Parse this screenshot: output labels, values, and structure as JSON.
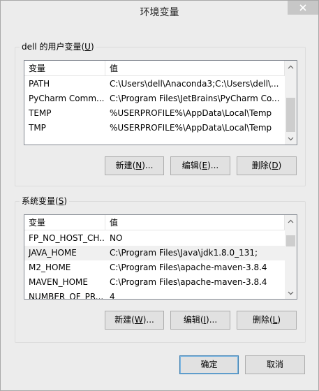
{
  "window": {
    "title": "环境变量"
  },
  "user_section": {
    "title_prefix": "dell 的用户变量(",
    "title_hotkey": "U",
    "title_suffix": ")",
    "columns": [
      "变量",
      "值"
    ],
    "rows": [
      {
        "name": "PATH",
        "value": "C:\\Users\\dell\\Anaconda3;C:\\Users\\dell\\..."
      },
      {
        "name": "PyCharm Comm...",
        "value": "C:\\Program Files\\JetBrains\\PyCharm Co..."
      },
      {
        "name": "TEMP",
        "value": "%USERPROFILE%\\AppData\\Local\\Temp"
      },
      {
        "name": "TMP",
        "value": "%USERPROFILE%\\AppData\\Local\\Temp"
      }
    ],
    "buttons": {
      "new": {
        "pre": "新建(",
        "key": "N",
        "post": ")..."
      },
      "edit": {
        "pre": "编辑(",
        "key": "E",
        "post": ")..."
      },
      "delete": {
        "pre": "删除(",
        "key": "D",
        "post": ")"
      }
    }
  },
  "system_section": {
    "title_prefix": "系统变量(",
    "title_hotkey": "S",
    "title_suffix": ")",
    "columns": [
      "变量",
      "值"
    ],
    "rows": [
      {
        "name": "FP_NO_HOST_CH...",
        "value": "NO"
      },
      {
        "name": "JAVA_HOME",
        "value": "C:\\Program Files\\Java\\jdk1.8.0_131;"
      },
      {
        "name": "M2_HOME",
        "value": "C:\\Program Files\\apache-maven-3.8.4"
      },
      {
        "name": "MAVEN_HOME",
        "value": "C:\\Program Files\\apache-maven-3.8.4"
      },
      {
        "name": "NUMBER_OF_PR...",
        "value": "4"
      }
    ],
    "selected_row": "JAVA_HOME",
    "buttons": {
      "new": {
        "pre": "新建(",
        "key": "W",
        "post": ")..."
      },
      "edit": {
        "pre": "编辑(",
        "key": "I",
        "post": ")..."
      },
      "delete": {
        "pre": "删除(",
        "key": "L",
        "post": ")"
      }
    }
  },
  "footer": {
    "ok": "确定",
    "cancel": "取消"
  }
}
